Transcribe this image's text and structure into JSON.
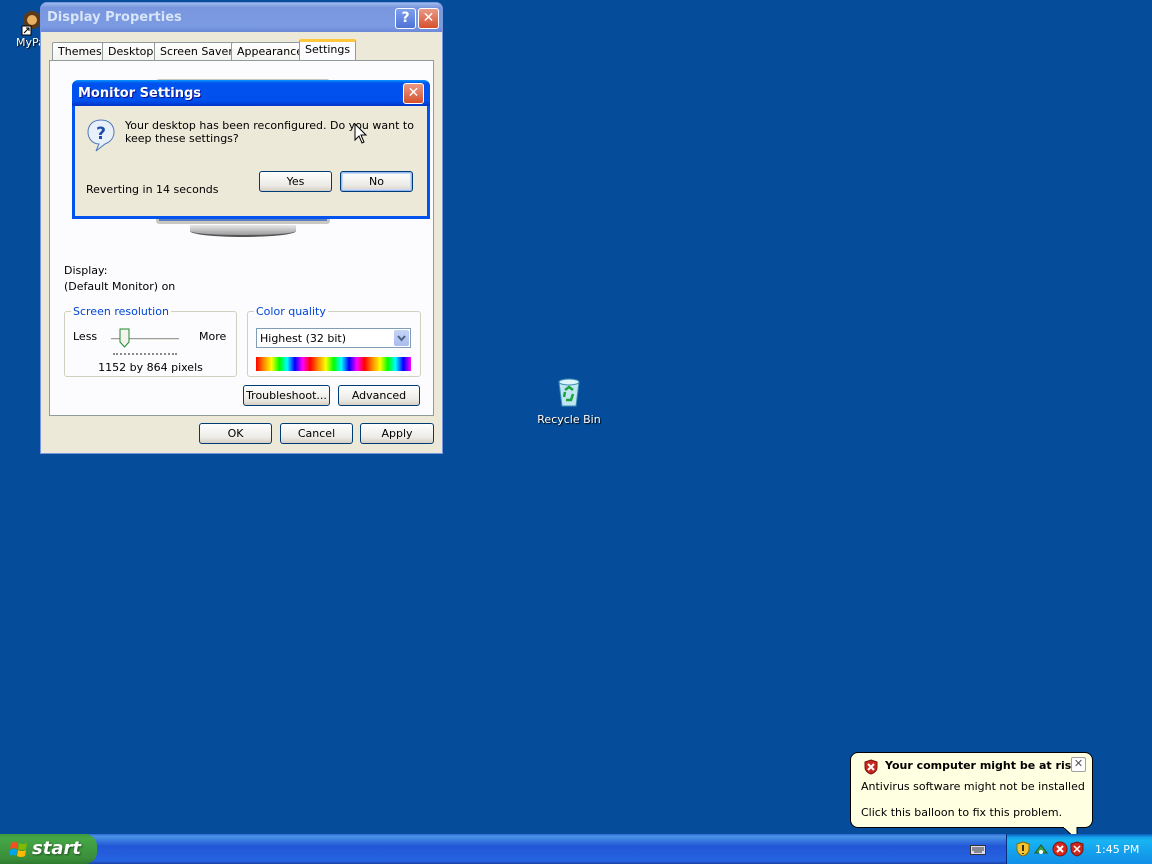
{
  "desktop": {
    "icons": [
      {
        "label": "MyPa",
        "icon": "shortcut-icon"
      },
      {
        "label": "Recycle Bin",
        "icon": "recycle-bin-icon"
      }
    ]
  },
  "display_properties": {
    "title": "Display Properties",
    "tabs": [
      {
        "label": "Themes"
      },
      {
        "label": "Desktop"
      },
      {
        "label": "Screen Saver"
      },
      {
        "label": "Appearance"
      },
      {
        "label": "Settings"
      }
    ],
    "selected_tab": "Settings",
    "display_label": "Display:",
    "display_value": "(Default Monitor) on",
    "screen_resolution": {
      "legend": "Screen resolution",
      "less_label": "Less",
      "more_label": "More",
      "value_text": "1152 by 864 pixels",
      "slider_level": 0.2
    },
    "color_quality": {
      "legend": "Color quality",
      "selected": "Highest (32 bit)"
    },
    "troubleshoot_label": "Troubleshoot...",
    "advanced_label": "Advanced",
    "ok_label": "OK",
    "cancel_label": "Cancel",
    "apply_label": "Apply"
  },
  "monitor_settings": {
    "title": "Monitor Settings",
    "message": "Your desktop has been reconfigured.  Do you want to keep these settings?",
    "countdown": "Reverting in 14 seconds",
    "yes_label": "Yes",
    "no_label": "No"
  },
  "taskbar": {
    "start_label": "start",
    "clock": "1:45 PM"
  },
  "balloon": {
    "title": "Your computer might be at risk",
    "line1": "Antivirus software might not be installed",
    "line2": "Click this balloon to fix this problem."
  },
  "colors": {
    "desktop": "#054D9B",
    "title_active": "#0053EE",
    "title_inactive": "#7A96DF",
    "dialog_face": "#ECE9D8",
    "balloon_bg": "#FFFFE1"
  }
}
